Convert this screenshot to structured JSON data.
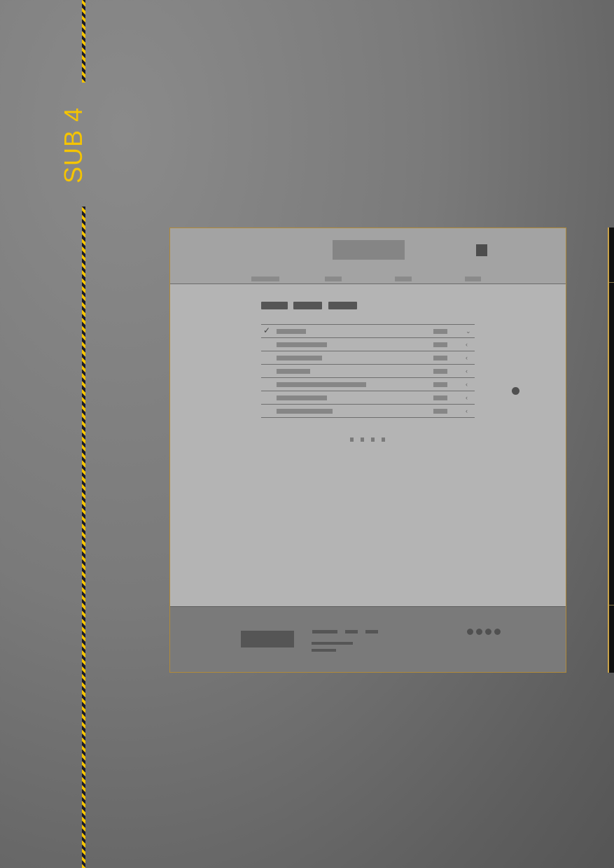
{
  "side_label": "SUB 4",
  "colors": {
    "accent": "#f5c400",
    "stripe_dark": "#1b1b2a",
    "frame_border": "#b08a3a",
    "page_bg": "#b4b4b4",
    "header_bg": "#a3a3a3",
    "footer_bg": "#7a7a7a"
  },
  "wireframe": {
    "header": {
      "logo_icon": "logo-placeholder",
      "action_icon": "square-icon",
      "nav_count": 4
    },
    "toolbar": {
      "button_count": 3
    },
    "list": {
      "row_count": 7,
      "rows": [
        {
          "checked": true,
          "chevron": "chevron-down-icon"
        },
        {
          "checked": false,
          "chevron": "chevron-left-icon"
        },
        {
          "checked": false,
          "chevron": "chevron-left-icon"
        },
        {
          "checked": false,
          "chevron": "chevron-left-icon"
        },
        {
          "checked": false,
          "chevron": "chevron-left-icon"
        },
        {
          "checked": false,
          "chevron": "chevron-left-icon"
        },
        {
          "checked": false,
          "chevron": "chevron-left-icon"
        }
      ]
    },
    "pager": {
      "page_count": 4
    },
    "footer": {
      "social_icon_count": 4
    }
  }
}
